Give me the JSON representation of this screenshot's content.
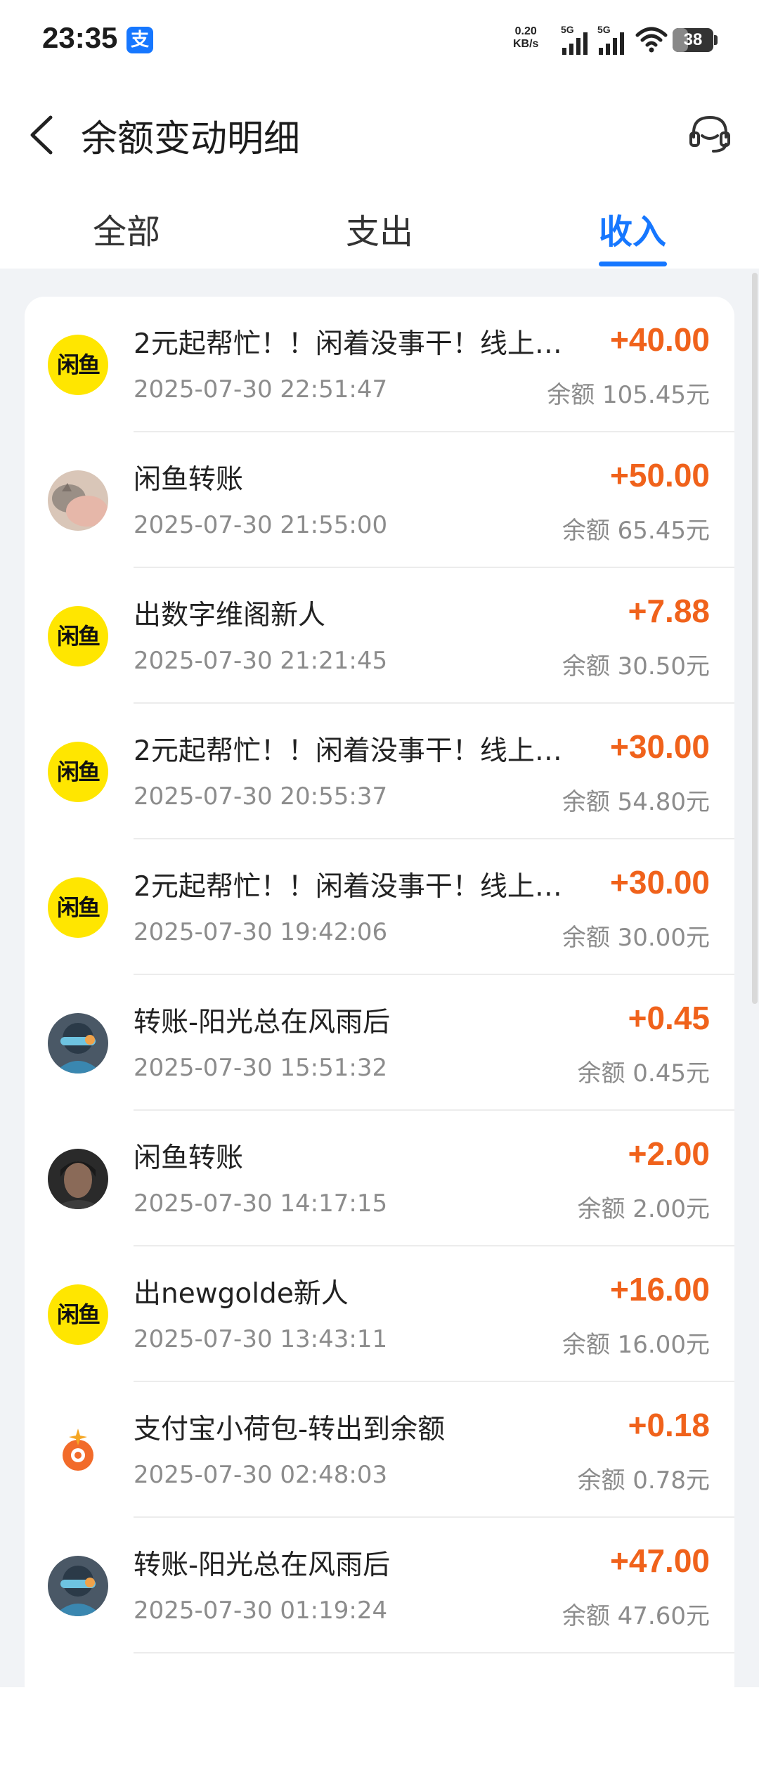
{
  "status": {
    "time": "23:35",
    "alipay_icon": "支",
    "net_speed_value": "0.20",
    "net_speed_unit": "KB/s",
    "signal1_label": "5G",
    "signal2_label": "5G",
    "battery": "38",
    "battery_level_percent": 38
  },
  "header": {
    "title": "余额变动明细",
    "back_icon": "chevron-left-icon",
    "service_icon": "headset-icon"
  },
  "tabs": [
    {
      "label": "全部",
      "active": false
    },
    {
      "label": "支出",
      "active": false
    },
    {
      "label": "收入",
      "active": true
    }
  ],
  "colors": {
    "accent": "#1677ff",
    "amount": "#f0621b",
    "xianyu_yellow": "#ffe600",
    "background": "#f1f3f6"
  },
  "transactions": [
    {
      "avatar": "xianyu-logo",
      "title": "2元起帮忙！！闲着没事干！线上…",
      "time": "2025-07-30 22:51:47",
      "amount": "+40.00",
      "balance": "余额 105.45元"
    },
    {
      "avatar": "user-photo-cat",
      "title": "闲鱼转账",
      "time": "2025-07-30 21:55:00",
      "amount": "+50.00",
      "balance": "余额 65.45元"
    },
    {
      "avatar": "xianyu-logo",
      "title": "出数字维阁新人",
      "time": "2025-07-30 21:21:45",
      "amount": "+7.88",
      "balance": "余额 30.50元"
    },
    {
      "avatar": "xianyu-logo",
      "title": "2元起帮忙！！闲着没事干！线上…",
      "time": "2025-07-30 20:55:37",
      "amount": "+30.00",
      "balance": "余额 54.80元"
    },
    {
      "avatar": "xianyu-logo",
      "title": "2元起帮忙！！闲着没事干！线上…",
      "time": "2025-07-30 19:42:06",
      "amount": "+30.00",
      "balance": "余额 30.00元"
    },
    {
      "avatar": "user-photo-anime",
      "title": "转账-阳光总在风雨后",
      "time": "2025-07-30 15:51:32",
      "amount": "+0.45",
      "balance": "余额 0.45元"
    },
    {
      "avatar": "user-photo-portrait",
      "title": "闲鱼转账",
      "time": "2025-07-30 14:17:15",
      "amount": "+2.00",
      "balance": "余额 2.00元"
    },
    {
      "avatar": "xianyu-logo",
      "title": "出newgolde新人",
      "time": "2025-07-30 13:43:11",
      "amount": "+16.00",
      "balance": "余额 16.00元"
    },
    {
      "avatar": "alipay-hebao-logo",
      "title": "支付宝小荷包-转出到余额",
      "time": "2025-07-30 02:48:03",
      "amount": "+0.18",
      "balance": "余额 0.78元"
    },
    {
      "avatar": "user-photo-anime",
      "title": "转账-阳光总在风雨后",
      "time": "2025-07-30 01:19:24",
      "amount": "+47.00",
      "balance": "余额 47.60元"
    }
  ],
  "xianyu_logo_text": "闲鱼"
}
